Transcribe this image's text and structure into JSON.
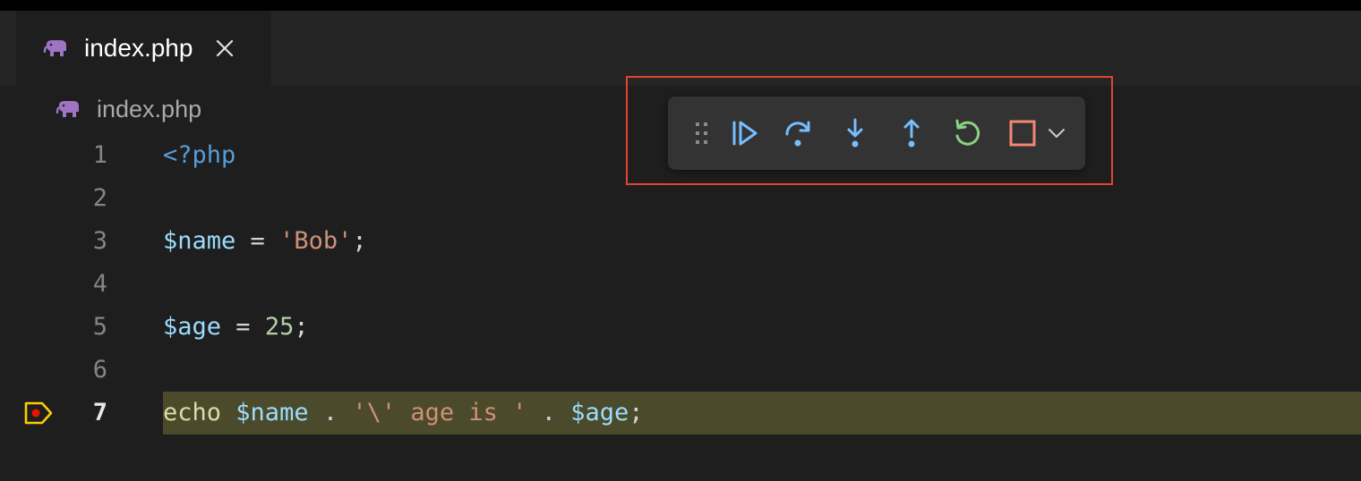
{
  "tabs": [
    {
      "label": "index.php",
      "icon": "php-elephant-icon",
      "active": true
    }
  ],
  "breadcrumb": {
    "label": "index.php",
    "icon": "php-elephant-icon"
  },
  "editor": {
    "current_line": 7,
    "lines": [
      {
        "number": "1",
        "tokens": [
          {
            "t": "<?php",
            "k": "tag"
          }
        ]
      },
      {
        "number": "2",
        "tokens": []
      },
      {
        "number": "3",
        "tokens": [
          {
            "t": "$name",
            "k": "var"
          },
          {
            "t": " = ",
            "k": "op"
          },
          {
            "t": "'Bob'",
            "k": "str"
          },
          {
            "t": ";",
            "k": "op"
          }
        ]
      },
      {
        "number": "4",
        "tokens": []
      },
      {
        "number": "5",
        "tokens": [
          {
            "t": "$age",
            "k": "var"
          },
          {
            "t": " = ",
            "k": "op"
          },
          {
            "t": "25",
            "k": "num"
          },
          {
            "t": ";",
            "k": "op"
          }
        ]
      },
      {
        "number": "6",
        "tokens": []
      },
      {
        "number": "7",
        "tokens": [
          {
            "t": "echo",
            "k": "kw"
          },
          {
            "t": " ",
            "k": "op"
          },
          {
            "t": "$name",
            "k": "var"
          },
          {
            "t": " . ",
            "k": "op"
          },
          {
            "t": "'\\' age is '",
            "k": "str"
          },
          {
            "t": " . ",
            "k": "op"
          },
          {
            "t": "$age",
            "k": "var"
          },
          {
            "t": ";",
            "k": "op"
          }
        ]
      }
    ]
  },
  "debug_toolbar": {
    "buttons": [
      {
        "name": "continue-button",
        "icon": "continue-icon"
      },
      {
        "name": "step-over-button",
        "icon": "step-over-icon"
      },
      {
        "name": "step-into-button",
        "icon": "step-into-icon"
      },
      {
        "name": "step-out-button",
        "icon": "step-out-icon"
      },
      {
        "name": "restart-button",
        "icon": "restart-icon"
      },
      {
        "name": "stop-button",
        "icon": "stop-icon"
      },
      {
        "name": "more-options-button",
        "icon": "chevron-down-icon"
      }
    ]
  },
  "colors": {
    "accent_blue": "#75beff",
    "restart_green": "#89d185",
    "stop_red": "#f48771",
    "php_purple": "#a074c4",
    "current_line_bg": "#4b4a2a",
    "breakpoint_yellow": "#ffcc00",
    "highlight_box": "#e2442f"
  }
}
